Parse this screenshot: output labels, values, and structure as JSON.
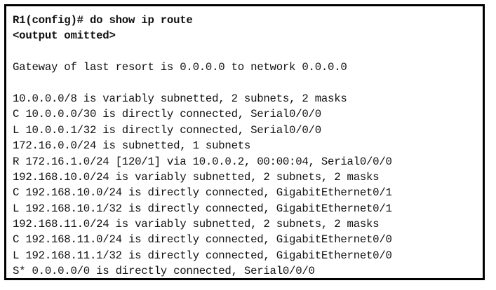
{
  "terminal": {
    "lines": [
      {
        "text": "R1(config)# do show ip route",
        "bold": true
      },
      {
        "text": "<output omitted>",
        "bold": true
      },
      {
        "text": "",
        "bold": false
      },
      {
        "text": "Gateway of last resort is 0.0.0.0 to network 0.0.0.0",
        "bold": false
      },
      {
        "text": "",
        "bold": false
      },
      {
        "text": "10.0.0.0/8 is variably subnetted, 2 subnets, 2 masks",
        "bold": false
      },
      {
        "text": "C 10.0.0.0/30 is directly connected, Serial0/0/0",
        "bold": false
      },
      {
        "text": "L 10.0.0.1/32 is directly connected, Serial0/0/0",
        "bold": false
      },
      {
        "text": "172.16.0.0/24 is subnetted, 1 subnets",
        "bold": false
      },
      {
        "text": "R 172.16.1.0/24 [120/1] via 10.0.0.2, 00:00:04, Serial0/0/0",
        "bold": false
      },
      {
        "text": "192.168.10.0/24 is variably subnetted, 2 subnets, 2 masks",
        "bold": false
      },
      {
        "text": "C 192.168.10.0/24 is directly connected, GigabitEthernet0/1",
        "bold": false
      },
      {
        "text": "L 192.168.10.1/32 is directly connected, GigabitEthernet0/1",
        "bold": false
      },
      {
        "text": "192.168.11.0/24 is variably subnetted, 2 subnets, 2 masks",
        "bold": false
      },
      {
        "text": "C 192.168.11.0/24 is directly connected, GigabitEthernet0/0",
        "bold": false
      },
      {
        "text": "L 192.168.11.1/32 is directly connected, GigabitEthernet0/0",
        "bold": false
      },
      {
        "text": "S* 0.0.0.0/0 is directly connected, Serial0/0/0",
        "bold": false
      }
    ]
  }
}
